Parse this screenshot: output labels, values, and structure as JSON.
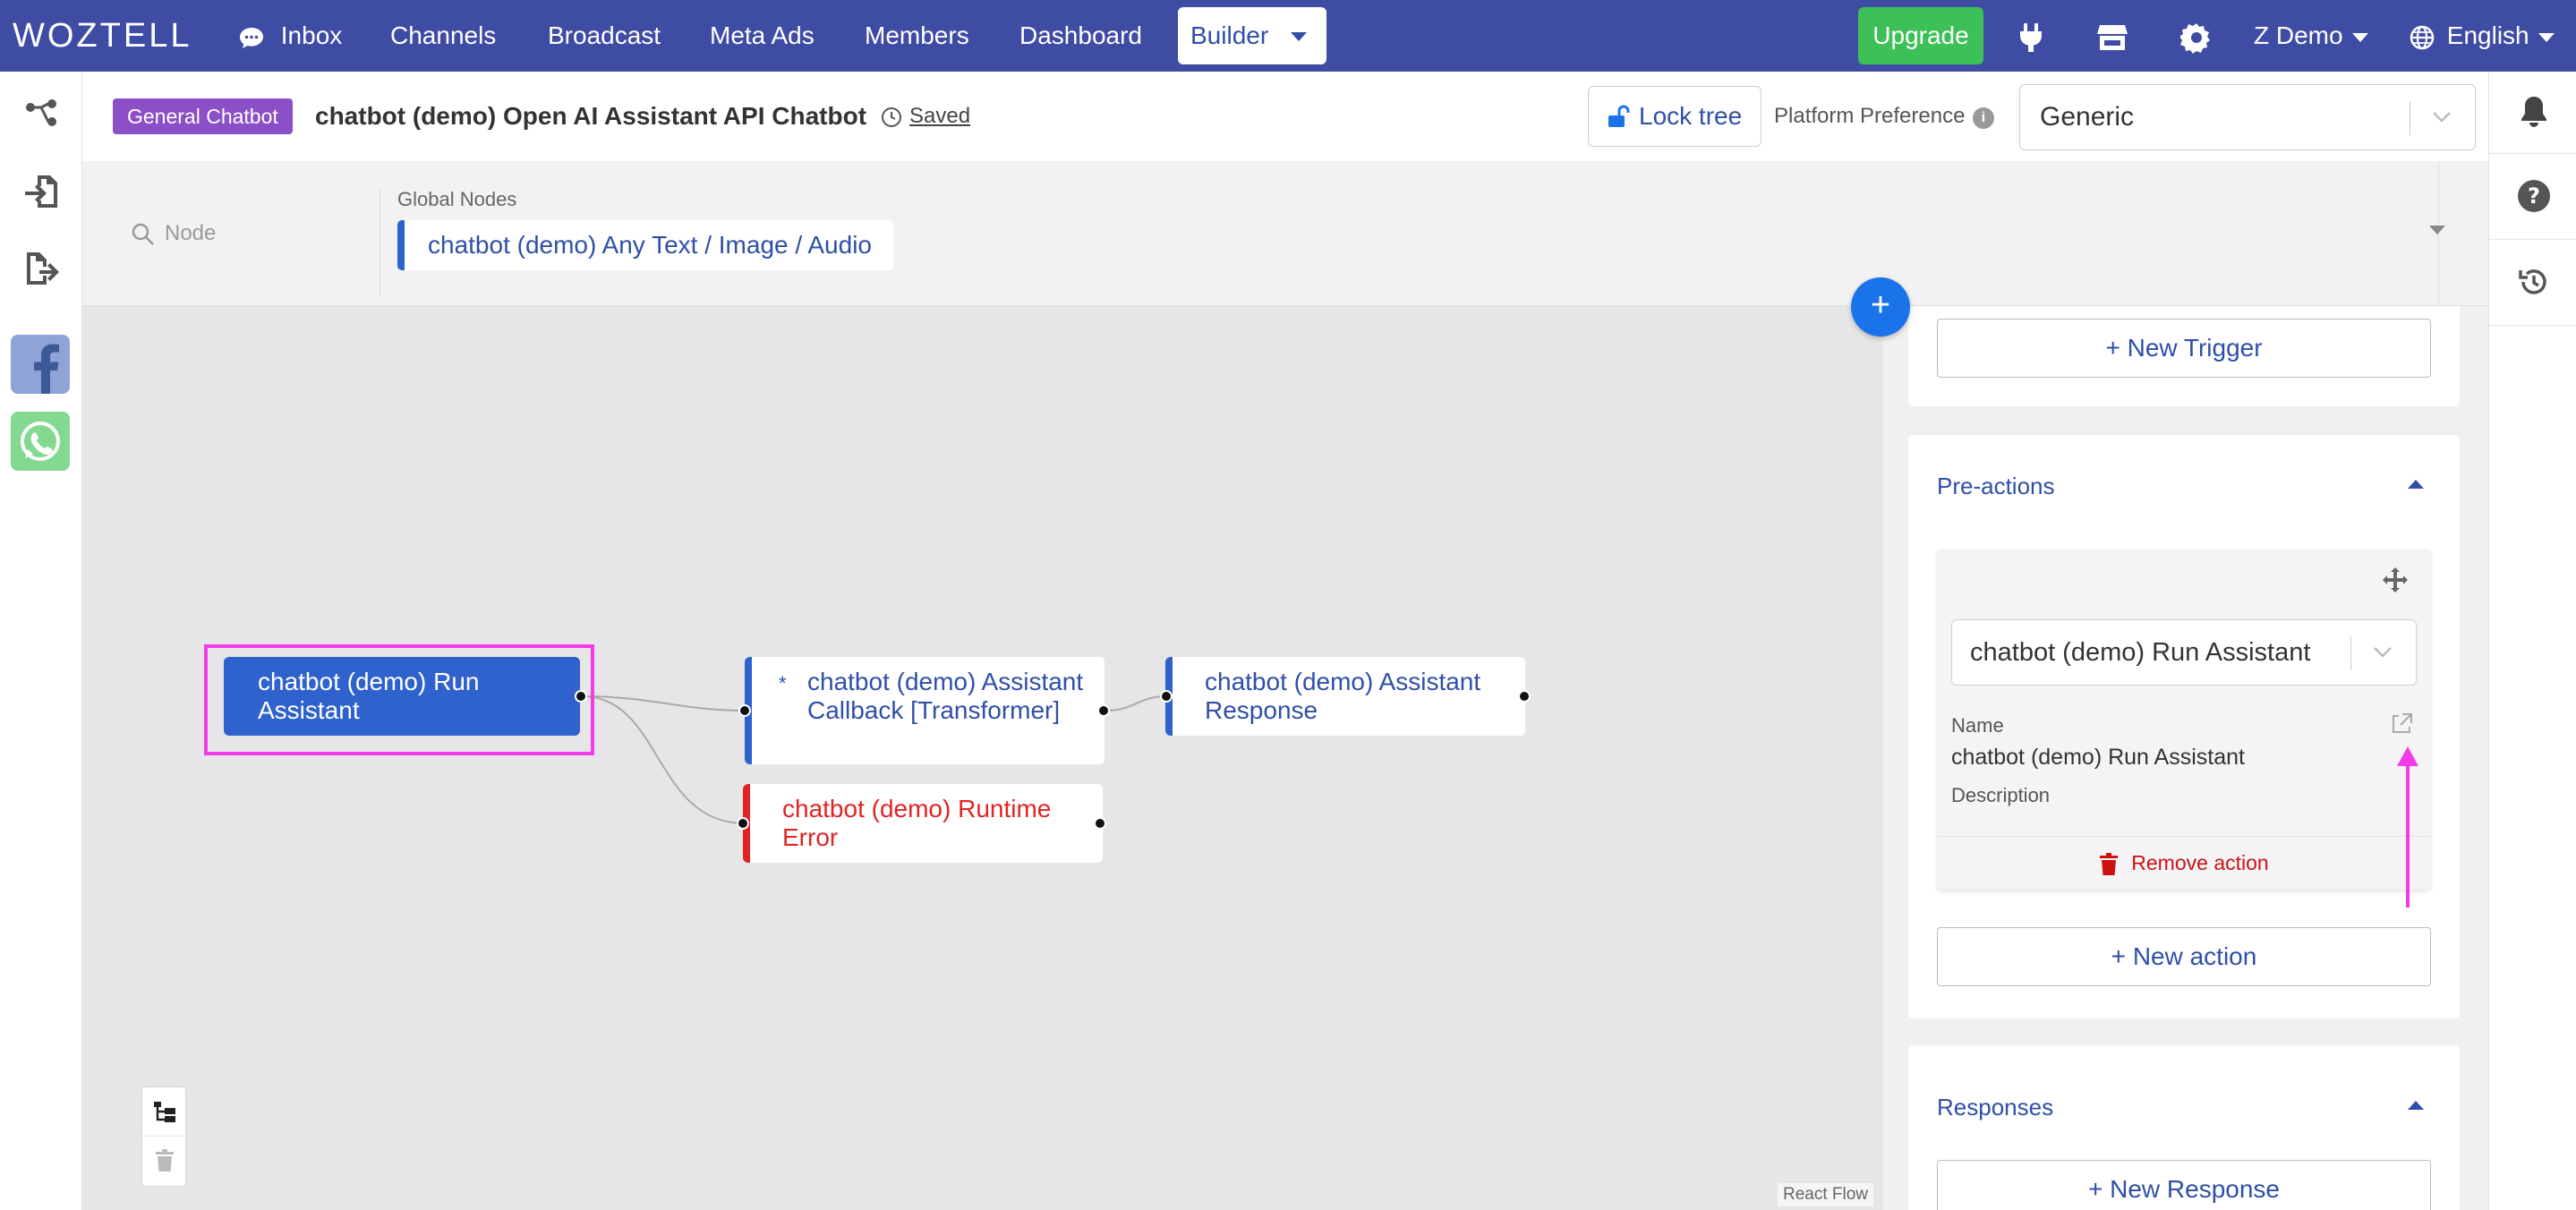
{
  "nav": {
    "logo": "WOZTELL",
    "items": [
      "Inbox",
      "Channels",
      "Broadcast",
      "Meta Ads",
      "Members",
      "Dashboard"
    ],
    "builder": "Builder",
    "upgrade": "Upgrade",
    "user": "Z Demo",
    "language": "English"
  },
  "header": {
    "tag": "General Chatbot",
    "title": "chatbot (demo) Open AI Assistant API Chatbot",
    "saved": "Saved",
    "lock_tree": "Lock tree",
    "platform_label": "Platform Preference",
    "platform_value": "Generic"
  },
  "toolbar": {
    "search_placeholder": "Node",
    "global_nodes_label": "Global Nodes",
    "global_node": "chatbot (demo) Any Text / Image / Audio"
  },
  "nodes": {
    "run": "chatbot (demo) Run Assistant",
    "callback": "chatbot (demo) Assistant Callback [Transformer]",
    "callback_star": "*",
    "response": "chatbot (demo) Assistant Response",
    "error": "chatbot (demo) Runtime Error"
  },
  "canvas": {
    "attribution": "React Flow",
    "plus": "+"
  },
  "panel": {
    "new_trigger": "New Trigger",
    "preactions_title": "Pre-actions",
    "action_select": "chatbot (demo) Run Assistant",
    "name_label": "Name",
    "name_value": "chatbot (demo) Run Assistant",
    "description_label": "Description",
    "remove_action": "Remove action",
    "new_action": "New action",
    "responses_title": "Responses",
    "new_response": "New Response"
  },
  "colors": {
    "nav_bg": "#3F4CA4",
    "accent_blue": "#2f62cc",
    "link_blue": "#2f4fa8",
    "upgrade_green": "#3CC057",
    "tag_purple": "#8B4FC8",
    "error_red": "#e02424",
    "highlight_pink": "#F23CE8"
  }
}
